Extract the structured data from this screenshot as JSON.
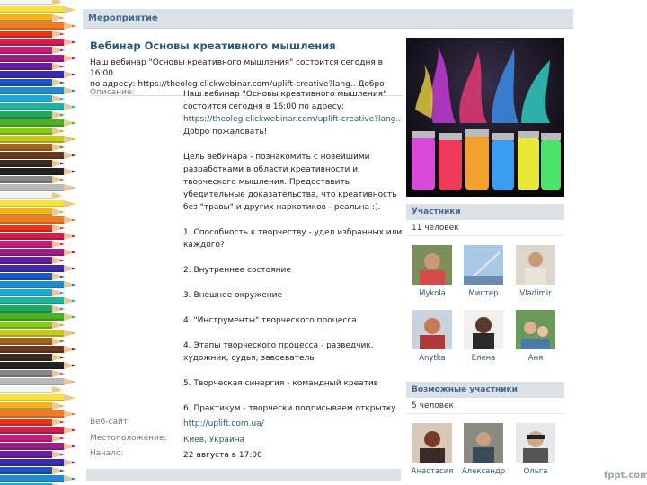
{
  "header": {
    "title": "Мероприятие"
  },
  "event": {
    "title": "Вебинар Основы креативного мышления",
    "status_line1": "Наш вебинар \"Основы креативного мышления\" состоится сегодня в 16:00",
    "status_line2": "по адресу: https://theoleg.clickwebinar.com/uplift-creative?lang.. Добро"
  },
  "description": {
    "label": "Описание:",
    "p1_l1": "Наш вебинар \"Основы креативного мышления\"",
    "p1_l2": "состоится сегодня в 16:00 по адресу:",
    "p1_link": "https://theoleg.clickwebinar.com/uplift-creative?lang..",
    "p1_l4": "Добро пожаловать!",
    "p2_l1": "Цель вебинара - познакомить с новейшими",
    "p2_l2": "разработками в области креативности и",
    "p2_l3": "творческого мышления. Предоставить",
    "p2_l4": "убедительные доказательства, что креативность",
    "p2_l5": "без \"травы\" и других наркотиков - реальна :].",
    "item1_l1": "1. Способность к творчеству - удел избранных или",
    "item1_l2": "каждого?",
    "item2": "2. Внутреннее состояние",
    "item3": "3. Внешнее окружение",
    "item4": "4. \"Инструменты\" творческого процесса",
    "item5_l1": "4. Этапы творческого процесса - разведчик,",
    "item5_l2": "художник, судья, завоеватель",
    "item6": "5. Творческая синергия - командный креатив",
    "item7": "6. Практикум - творчески подписываем открытку"
  },
  "details": {
    "website_label": "Веб-сайт:",
    "website_value": "http://uplift.com.ua/",
    "location_label": "Местоположение:",
    "location_value": "Киев, Украина",
    "start_label": "Начало:",
    "start_value": "22 августа в 17:00"
  },
  "participants": {
    "heading": "Участники",
    "count": "11 человек",
    "members": [
      {
        "name": "Mykola"
      },
      {
        "name": "Мистер"
      },
      {
        "name": "Vladimir"
      },
      {
        "name": "Anytka"
      },
      {
        "name": "Елена"
      },
      {
        "name": "Аня"
      }
    ]
  },
  "possible": {
    "heading": "Возможные участники",
    "count": "5 человек",
    "members": [
      {
        "name": "Анастасия"
      },
      {
        "name": "Александр"
      },
      {
        "name": "Ольга"
      }
    ]
  },
  "watermark": "fppt.com",
  "colors": {
    "accent": "#45688e",
    "link": "#2b587a",
    "header_bg": "#dae2e8"
  }
}
